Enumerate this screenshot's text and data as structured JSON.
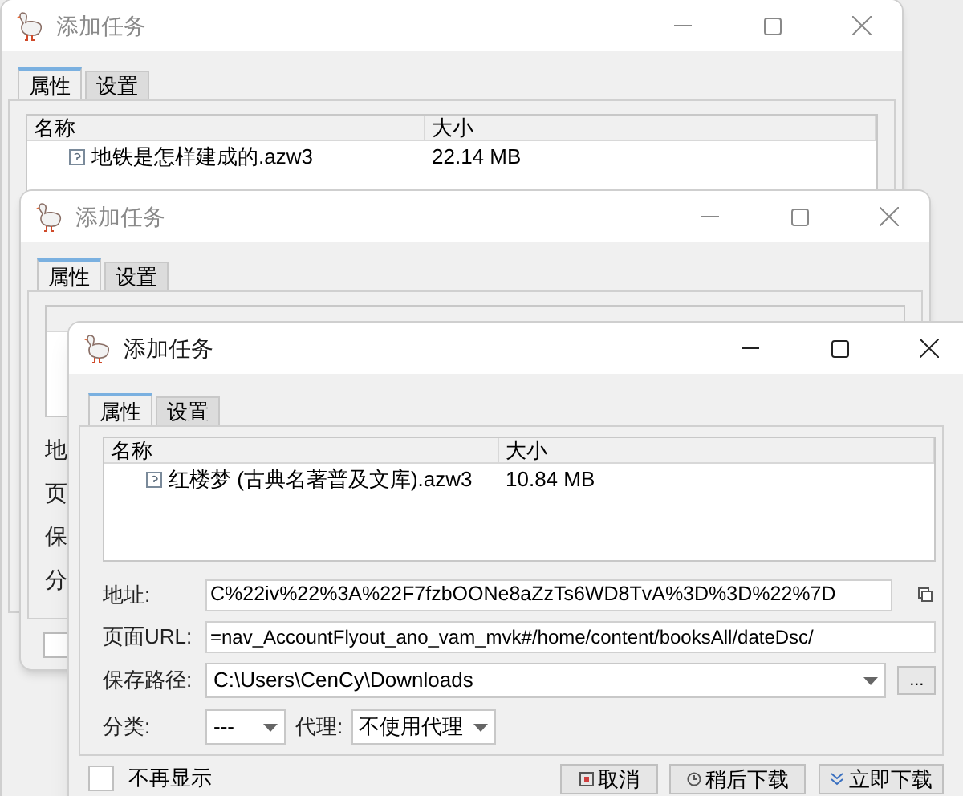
{
  "windows": [
    {
      "kind": "back",
      "title": "添加任务",
      "tabs": [
        {
          "label": "属性",
          "selected": true
        },
        {
          "label": "设置",
          "selected": false
        }
      ],
      "columns": [
        "名称",
        "大小"
      ],
      "rows": [
        {
          "name": "地铁是怎样建成的.azw3",
          "size": "22.14 MB"
        }
      ]
    },
    {
      "kind": "back",
      "title": "添加任务",
      "tabs": [
        {
          "label": "属性",
          "selected": true
        },
        {
          "label": "设置",
          "selected": false
        }
      ],
      "labels": [
        "地",
        "页",
        "保",
        "分"
      ],
      "dont_show": {
        "checked": false
      }
    },
    {
      "kind": "front",
      "title": "添加任务",
      "tabs": [
        {
          "label": "属性",
          "selected": true
        },
        {
          "label": "设置",
          "selected": false
        }
      ],
      "columns": [
        "名称",
        "大小"
      ],
      "rows": [
        {
          "name": "红楼梦 (古典名著普及文库).azw3",
          "size": "10.84 MB"
        }
      ],
      "address": {
        "label": "地址:",
        "value": "C%22iv%22%3A%22F7fzbOONe8aZzTs6WD8TvA%3D%3D%22%7D"
      },
      "page_url": {
        "label": "页面URL:",
        "value": "=nav_AccountFlyout_ano_vam_mvk#/home/content/booksAll/dateDsc/"
      },
      "save_path": {
        "label": "保存路径:",
        "value": "C:\\Users\\CenCy\\Downloads",
        "browse": "..."
      },
      "category": {
        "label": "分类:",
        "value": "---"
      },
      "proxy": {
        "label": "代理:",
        "value": "不使用代理"
      },
      "dont_show": {
        "label": "不再显示",
        "checked": false
      },
      "buttons": [
        "取消",
        "稍后下载",
        "立即下载"
      ]
    }
  ]
}
